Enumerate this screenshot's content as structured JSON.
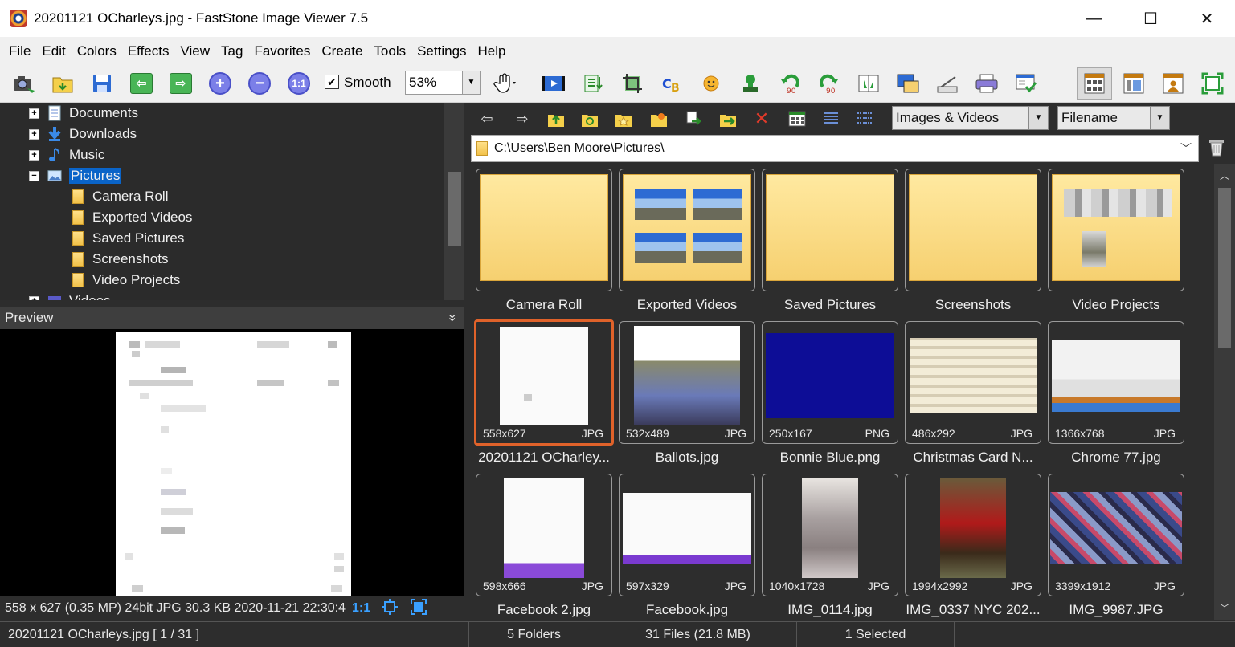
{
  "window": {
    "title": "20201121 OCharleys.jpg  -  FastStone Image Viewer 7.5",
    "minimize": "—",
    "maximize": "☐",
    "close": "✕"
  },
  "menu": [
    "File",
    "Edit",
    "Colors",
    "Effects",
    "View",
    "Tag",
    "Favorites",
    "Create",
    "Tools",
    "Settings",
    "Help"
  ],
  "toolbar": {
    "smooth_label": "Smooth",
    "smooth_checked": true,
    "zoom_value": "53%"
  },
  "tree": {
    "items": [
      {
        "label": "Documents",
        "icon": "document-icon",
        "expander": "+"
      },
      {
        "label": "Downloads",
        "icon": "download-arrow-icon",
        "expander": "+"
      },
      {
        "label": "Music",
        "icon": "music-note-icon",
        "expander": "+"
      },
      {
        "label": "Pictures",
        "icon": "picture-icon",
        "expander": "−",
        "selected": true
      },
      {
        "label": "Camera Roll",
        "icon": "folder-icon"
      },
      {
        "label": "Exported Videos",
        "icon": "folder-icon"
      },
      {
        "label": "Saved Pictures",
        "icon": "folder-icon"
      },
      {
        "label": "Screenshots",
        "icon": "folder-icon"
      },
      {
        "label": "Video Projects",
        "icon": "folder-icon"
      },
      {
        "label": "Videos",
        "icon": "video-icon",
        "expander": "+"
      }
    ]
  },
  "preview": {
    "header": "Preview",
    "collapse": "»",
    "info": "558 x 627 (0.35 MP)  24bit  JPG   30.3 KB   2020-11-21 22:30:4",
    "actual_size": "1:1"
  },
  "browser": {
    "filter_value": "Images & Videos",
    "sort_value": "Filename",
    "path": "C:\\Users\\Ben Moore\\Pictures\\",
    "folders": [
      {
        "name": "Camera Roll"
      },
      {
        "name": "Exported Videos"
      },
      {
        "name": "Saved Pictures"
      },
      {
        "name": "Screenshots"
      },
      {
        "name": "Video Projects"
      }
    ],
    "files": [
      {
        "name": "20201121 OCharley...",
        "dims": "558x627",
        "ext": "JPG",
        "selected": true
      },
      {
        "name": "Ballots.jpg",
        "dims": "532x489",
        "ext": "JPG"
      },
      {
        "name": "Bonnie Blue.png",
        "dims": "250x167",
        "ext": "PNG"
      },
      {
        "name": "Christmas Card N...",
        "dims": "486x292",
        "ext": "JPG"
      },
      {
        "name": "Chrome 77.jpg",
        "dims": "1366x768",
        "ext": "JPG"
      },
      {
        "name": "Facebook 2.jpg",
        "dims": "598x666",
        "ext": "JPG"
      },
      {
        "name": "Facebook.jpg",
        "dims": "597x329",
        "ext": "JPG"
      },
      {
        "name": "IMG_0114.jpg",
        "dims": "1040x1728",
        "ext": "JPG"
      },
      {
        "name": "IMG_0337 NYC 202...",
        "dims": "1994x2992",
        "ext": "JPG"
      },
      {
        "name": "IMG_9987.JPG",
        "dims": "3399x1912",
        "ext": "JPG"
      }
    ]
  },
  "status": {
    "file": "20201121 OCharleys.jpg [ 1 / 31 ]",
    "folders": "5 Folders",
    "files": "31 Files (21.8 MB)",
    "selected": "1 Selected"
  },
  "colors": {
    "selection_blue": "#0a64c8",
    "selected_tile_border": "#e0622a",
    "pane_bg": "#2d2d2d"
  }
}
